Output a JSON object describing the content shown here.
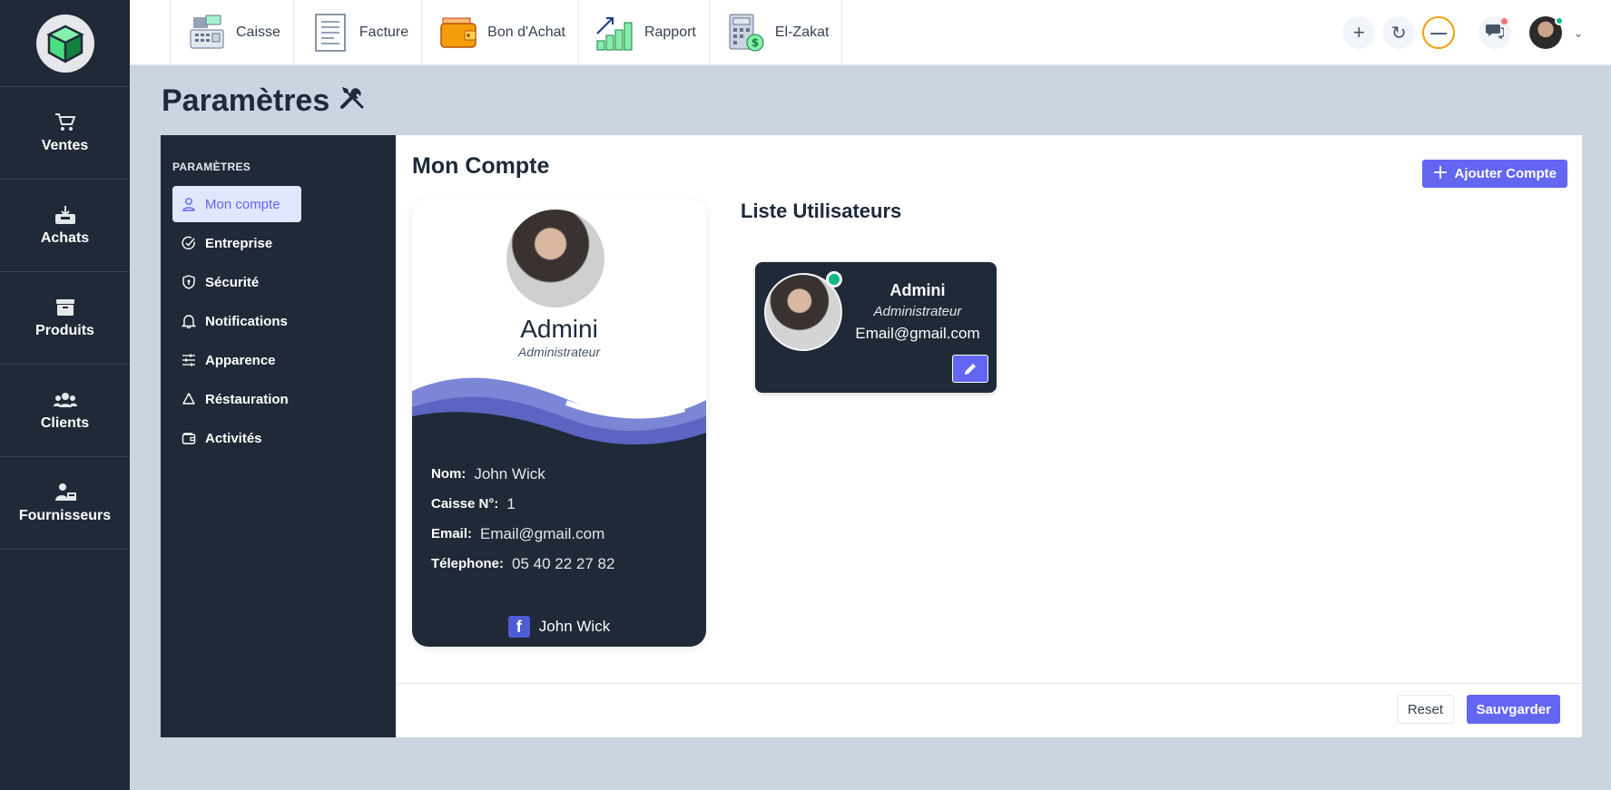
{
  "colors": {
    "rail": "#1f2937",
    "accent": "#6366f1",
    "page_bg": "#cbd5e1",
    "online": "#10b981"
  },
  "rail": {
    "logo_icon": "cube-logo-icon",
    "items": [
      {
        "label": "Ventes",
        "icon": "cart-icon"
      },
      {
        "label": "Achats",
        "icon": "inbox-download-icon"
      },
      {
        "label": "Produits",
        "icon": "archive-box-icon"
      },
      {
        "label": "Clients",
        "icon": "users-icon"
      },
      {
        "label": "Fournisseurs",
        "icon": "supplier-icon"
      }
    ]
  },
  "topnav": {
    "items": [
      {
        "label": "Caisse",
        "icon": "cash-register-icon"
      },
      {
        "label": "Facture",
        "icon": "invoice-icon"
      },
      {
        "label": "Bon d'Achat",
        "icon": "wallet-icon"
      },
      {
        "label": "Rapport",
        "icon": "bar-chart-icon"
      },
      {
        "label": "El-Zakat",
        "icon": "calculator-icon"
      }
    ],
    "right": {
      "add": "+",
      "refresh": "↻",
      "minimize": "—",
      "chat_icon": "chat-icon",
      "caret": "⌄"
    }
  },
  "page": {
    "title": "Paramètres",
    "title_icon": "tools-icon"
  },
  "settings_nav": {
    "title": "PARAMÈTRES",
    "items": [
      {
        "label": "Mon compte",
        "icon": "user-icon",
        "active": true
      },
      {
        "label": "Entreprise",
        "icon": "check-circle-icon"
      },
      {
        "label": "Sécurité",
        "icon": "shield-icon"
      },
      {
        "label": "Notifications",
        "icon": "bell-icon"
      },
      {
        "label": "Apparence",
        "icon": "sliders-icon"
      },
      {
        "label": "Réstauration",
        "icon": "recycle-icon"
      },
      {
        "label": "Activités",
        "icon": "wallet-icon"
      }
    ]
  },
  "content": {
    "title": "Mon Compte",
    "add_account_label": "Ajouter Compte",
    "profile": {
      "name": "Admini",
      "role": "Administrateur",
      "fields": [
        {
          "label": "Nom:",
          "value": "John Wick"
        },
        {
          "label": "Caisse N°:",
          "value": "1"
        },
        {
          "label": "Email:",
          "value": "Email@gmail.com"
        },
        {
          "label": "Télephone:",
          "value": "05 40 22 27 82"
        }
      ],
      "facebook_letter": "f",
      "facebook": "John Wick"
    },
    "users_title": "Liste Utilisateurs",
    "users": [
      {
        "name": "Admini",
        "role": "Administrateur",
        "email": "Email@gmail.com"
      }
    ],
    "reset_label": "Reset",
    "save_label": "Sauvgarder"
  }
}
